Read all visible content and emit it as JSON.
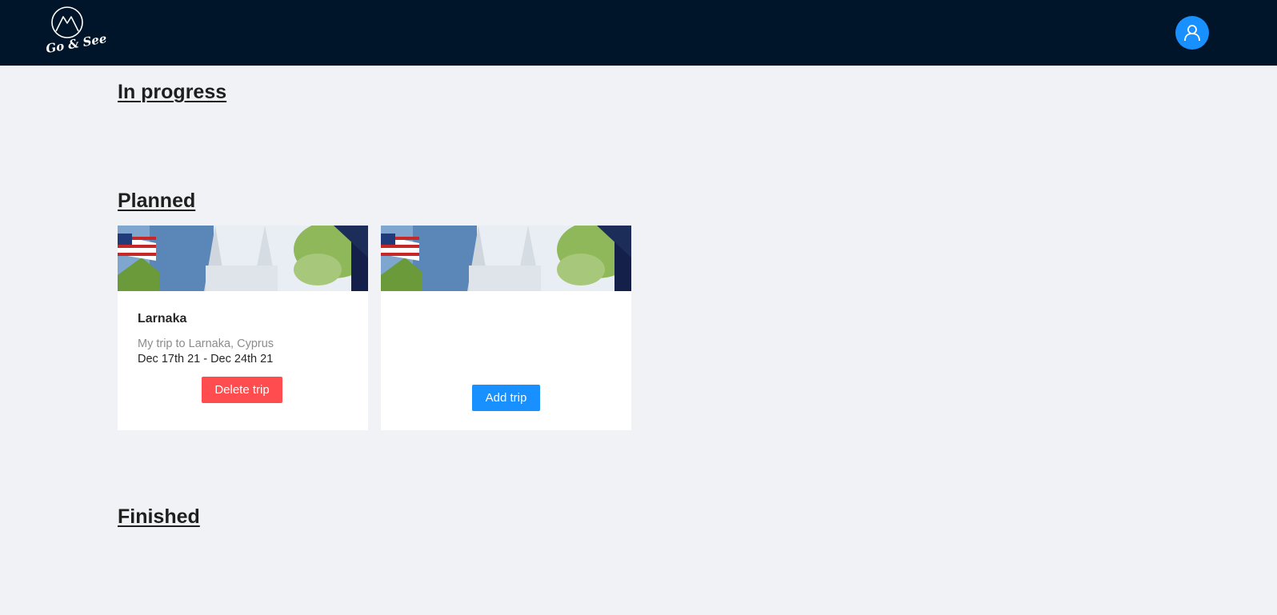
{
  "header": {
    "logo_text": "Go & See",
    "colors": {
      "background": "#001529",
      "avatar": "#1890ff"
    },
    "avatar_icon": "user-icon"
  },
  "sections": {
    "in_progress": {
      "title": "In progress"
    },
    "planned": {
      "title": "Planned",
      "trips": [
        {
          "name": "Larnaka",
          "description": "My trip to Larnaka, Cyprus",
          "dates": "Dec 17th 21 - Dec 24th 21",
          "action_label": "Delete trip"
        }
      ],
      "add_card": {
        "action_label": "Add trip"
      }
    },
    "finished": {
      "title": "Finished"
    }
  },
  "colors": {
    "page_background": "#f0f2f5",
    "delete_button": "#ff4d4f",
    "add_button": "#1890ff"
  }
}
